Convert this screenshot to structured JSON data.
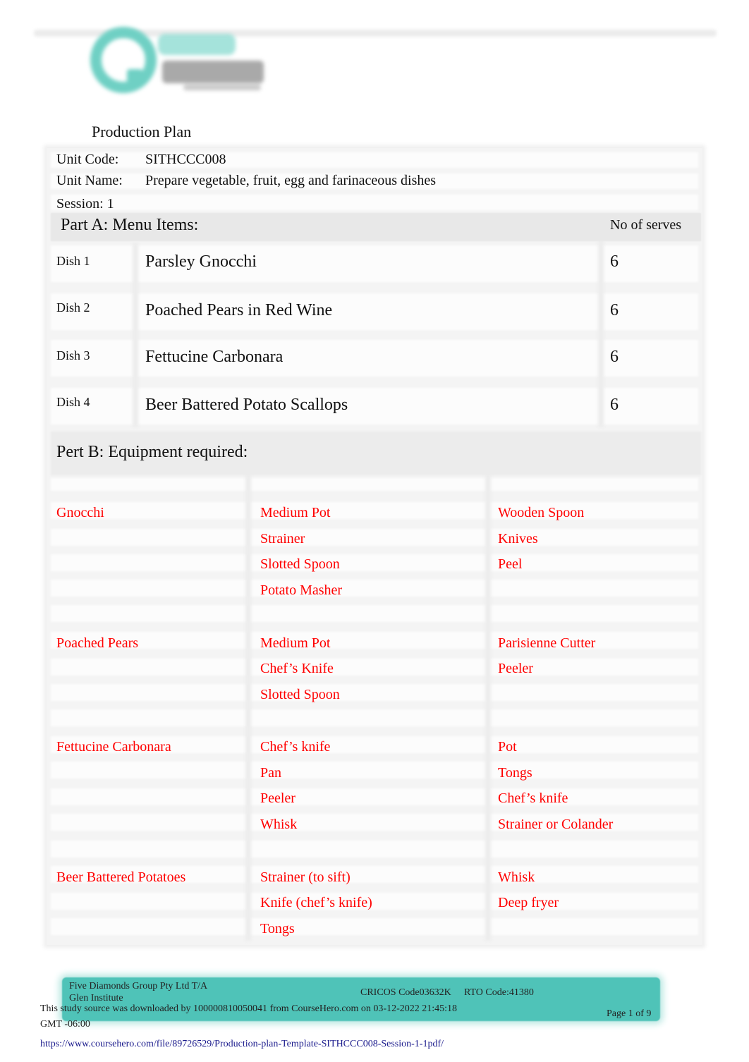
{
  "document": {
    "title": "Production Plan",
    "logo_name": "Glen Institute"
  },
  "header": {
    "unit_code_label": "Unit Code:",
    "unit_code": "SITHCCC008",
    "unit_name_label": "Unit Name:",
    "unit_name": "Prepare vegetable, fruit, egg and farinaceous dishes",
    "session": "Session: 1"
  },
  "part_a": {
    "title": "Part A: Menu Items:",
    "serves_header": "No of serves",
    "dishes": [
      {
        "label": "Dish 1",
        "name": "Parsley Gnocchi",
        "serves": "6"
      },
      {
        "label": "Dish 2",
        "name": "Poached Pears in Red Wine",
        "serves": "6"
      },
      {
        "label": "Dish 3",
        "name": "Fettucine Carbonara",
        "serves": "6"
      },
      {
        "label": "Dish 4",
        "name": "Beer Battered Potato Scallops",
        "serves": "6"
      }
    ]
  },
  "part_b": {
    "title": "Pert B: Equipment required:",
    "text_color": "#ff0000",
    "groups": [
      {
        "dish": "Gnocchi",
        "col2": [
          "Medium Pot",
          "Strainer",
          "Slotted Spoon",
          "Potato Masher"
        ],
        "col3": [
          "Wooden Spoon",
          "Knives",
          "Peel"
        ]
      },
      {
        "dish": "Poached Pears",
        "col2": [
          "Medium Pot",
          "Chef’s Knife",
          "Slotted Spoon"
        ],
        "col3": [
          "Parisienne Cutter",
          "Peeler"
        ]
      },
      {
        "dish": "Fettucine Carbonara",
        "col2": [
          "Chef’s knife",
          "Pan",
          "Peeler",
          "Whisk"
        ],
        "col3": [
          "Pot",
          "Tongs",
          "Chef’s knife",
          "Strainer or Colander"
        ]
      },
      {
        "dish": "Beer Battered Potatoes",
        "col2": [
          "Strainer (to sift)",
          "Knife (chef’s knife)",
          "Tongs"
        ],
        "col3": [
          "Whisk",
          "Deep fryer"
        ]
      }
    ]
  },
  "footer": {
    "company_line1": "Five Diamonds Group Pty Ltd T/A",
    "company_line2": "Glen Institute",
    "cricos": "CRICOS Code03632K",
    "rto": "RTO Code:41380",
    "page": "Page 1 of 9",
    "download_notice": "This study source was downloaded by 100000810050041 from CourseHero.com on 03-12-2022 21:45:18",
    "timezone": "GMT -06:00",
    "url": "https://www.coursehero.com/file/89726529/Production-plan-Template-SITHCCC008-Session-1-1pdf/",
    "brand_color": "#4fc3b8"
  }
}
